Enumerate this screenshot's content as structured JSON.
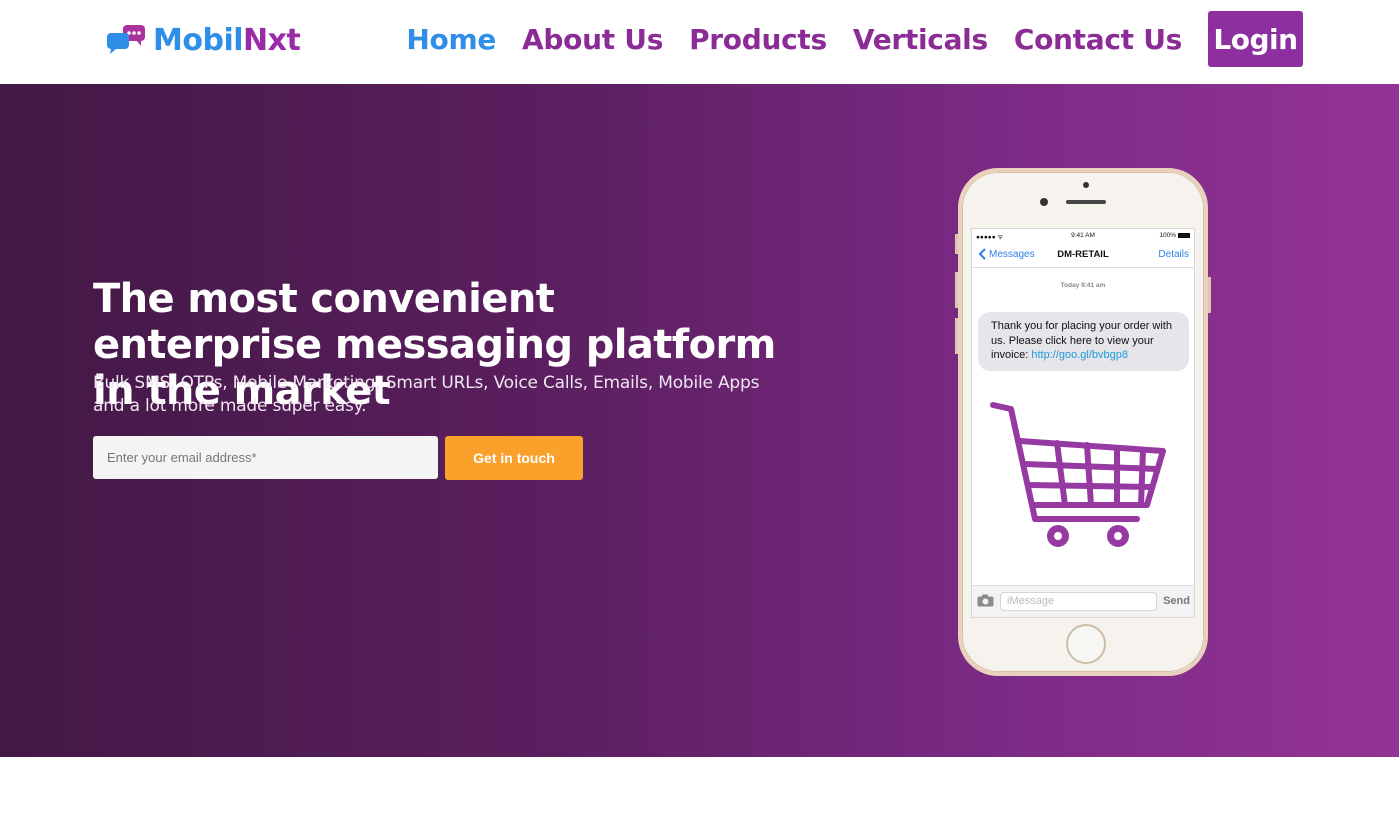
{
  "header": {
    "logo": {
      "text_a": "Mobil",
      "text_b": "Nxt",
      "icon": "chat-bubbles-icon"
    },
    "nav": [
      {
        "label": "Home",
        "active": true
      },
      {
        "label": "About Us",
        "active": false
      },
      {
        "label": "Products",
        "active": false
      },
      {
        "label": "Verticals",
        "active": false
      },
      {
        "label": "Contact Us",
        "active": false
      }
    ],
    "login_label": "Login"
  },
  "hero": {
    "headline": "The most convenient enterprise messaging platform in the market",
    "subline": "Bulk SMS, OTPs, Mobile Marketing, Smart URLs, Voice Calls, Emails, Mobile Apps and a lot more made super easy.",
    "email_placeholder": "Enter your email address*",
    "cta_label": "Get in touch"
  },
  "phone": {
    "status": {
      "signal": "●●●●● ᯤ",
      "time": "9:41 AM",
      "battery": "100%"
    },
    "nav": {
      "back_label": "Messages",
      "title": "DM-RETAIL",
      "details_label": "Details"
    },
    "timestamp": "Today 9:41 am",
    "message": {
      "text": "Thank you for placing your order with us. Please click here to view your invoice: ",
      "link": "http://goo.gl/bvbgp8"
    },
    "input_placeholder": "iMessage",
    "send_label": "Send"
  },
  "colors": {
    "brand_purple": "#8e2fa0",
    "brand_blue": "#2f8fe8",
    "cta_orange": "#f9a12b",
    "hero_gradient_start": "#421845",
    "hero_gradient_end": "#943396"
  }
}
